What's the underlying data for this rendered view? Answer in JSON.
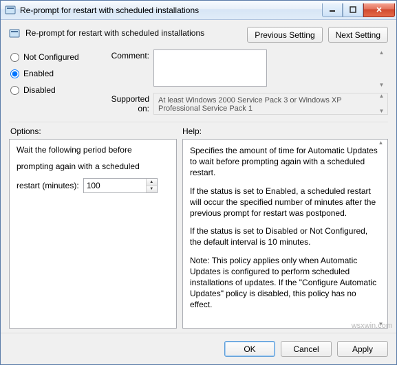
{
  "window": {
    "title": "Re-prompt for restart with scheduled installations"
  },
  "header": {
    "policy_name": "Re-prompt for restart with scheduled installations",
    "previous_btn": "Previous Setting",
    "next_btn": "Next Setting"
  },
  "radio": {
    "not_configured": "Not Configured",
    "enabled": "Enabled",
    "disabled": "Disabled",
    "selected": "enabled"
  },
  "fields": {
    "comment_label": "Comment:",
    "comment_value": "",
    "supported_label": "Supported on:",
    "supported_text": "At least Windows 2000 Service Pack 3 or Windows XP Professional Service Pack 1"
  },
  "options": {
    "section_label": "Options:",
    "line1": "Wait the following period before",
    "line2": "prompting again with a scheduled",
    "restart_label": "restart (minutes):",
    "restart_value": "100"
  },
  "help": {
    "section_label": "Help:",
    "p1": "Specifies the amount of time for Automatic Updates to wait before prompting again with a scheduled restart.",
    "p2": "If the status is set to Enabled, a scheduled restart will occur the specified number of minutes after the previous prompt for restart was postponed.",
    "p3": "If the status is set to Disabled or Not Configured, the default interval is 10 minutes.",
    "p4": "Note: This policy applies only when Automatic Updates is configured to perform scheduled installations of updates. If the \"Configure Automatic Updates\" policy is disabled, this policy has no effect."
  },
  "footer": {
    "ok": "OK",
    "cancel": "Cancel",
    "apply": "Apply"
  },
  "watermark": "wsxwin.com"
}
